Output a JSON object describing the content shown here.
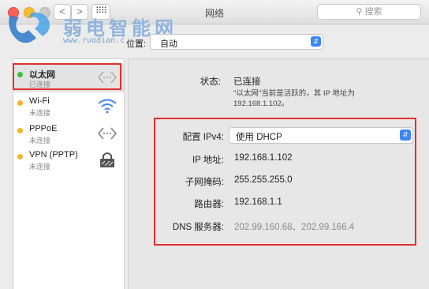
{
  "window": {
    "title": "网络",
    "search_placeholder": "搜索"
  },
  "nav": {
    "back": "<",
    "forward": ">",
    "grid": "⠿⠿"
  },
  "watermark": {
    "brand": "弱电智能网",
    "url": "www.ruodian.c"
  },
  "location": {
    "label": "位置:",
    "value": "自动"
  },
  "services": [
    {
      "name": "以太网",
      "status": "已连接",
      "icon": "ethernet-arrows-icon",
      "color": "#3ac140"
    },
    {
      "name": "Wi-Fi",
      "status": "未连接",
      "icon": "wifi-icon",
      "color": "#f4b52a"
    },
    {
      "name": "PPPoE",
      "status": "未连接",
      "icon": "pppoe-arrows-icon",
      "color": "#f4b52a"
    },
    {
      "name": "VPN (PPTP)",
      "status": "未连接",
      "icon": "vpn-lock-icon",
      "color": "#f4b52a"
    }
  ],
  "detail": {
    "status_label": "状态:",
    "status_value": "已连接",
    "status_note_line1": "\"以太网\"当前是活跃的，其 IP 地址为",
    "status_note_line2": "192.168.1.102。",
    "ipv4_label": "配置 IPv4:",
    "ipv4_value": "使用 DHCP",
    "ip_label": "IP 地址:",
    "ip_value": "192.168.1.102",
    "mask_label": "子网掩码:",
    "mask_value": "255.255.255.0",
    "router_label": "路由器:",
    "router_value": "192.168.1.1",
    "dns_label": "DNS 服务器:",
    "dns_value": "202.99.160.68、202.99.166.4"
  },
  "colors": {
    "highlight_box": "#e0302e",
    "accent": "#3c87f7"
  }
}
